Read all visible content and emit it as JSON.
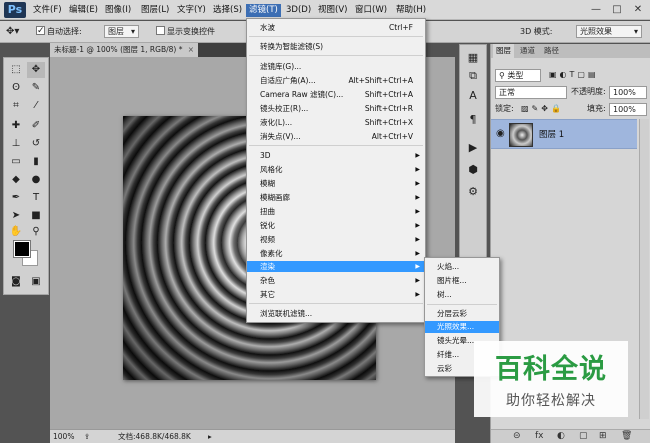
{
  "app": {
    "logo": "Ps"
  },
  "menubar": {
    "items": [
      "文件(F)",
      "编辑(E)",
      "图像(I)",
      "图层(L)",
      "文字(Y)",
      "选择(S)",
      "滤镜(T)",
      "3D(D)",
      "视图(V)",
      "窗口(W)",
      "帮助(H)"
    ],
    "active": "滤镜(T)",
    "window_controls": [
      "—",
      "□",
      "✕"
    ]
  },
  "options": {
    "auto_select_label": "自动选择:",
    "auto_select_checked": true,
    "auto_select_target": "图层",
    "show_transform_label": "显示变换控件",
    "mode_3d_label": "3D 模式:",
    "workspace": "光照效果"
  },
  "document": {
    "tab_title": "未标题-1 @ 100% (图层 1, RGB/8) *",
    "close": "×"
  },
  "statusbar": {
    "zoom": "100%",
    "doc_info": "文档:468.8K/468.8K"
  },
  "filter_menu": {
    "items": [
      {
        "label": "水波",
        "shortcut": "Ctrl+F"
      },
      {
        "label": "转换为智能滤镜(S)",
        "shortcut": ""
      },
      {
        "label": "滤镜库(G)...",
        "shortcut": ""
      },
      {
        "label": "自适应广角(A)...",
        "shortcut": "Alt+Shift+Ctrl+A"
      },
      {
        "label": "Camera Raw 滤镜(C)...",
        "shortcut": "Shift+Ctrl+A"
      },
      {
        "label": "镜头校正(R)...",
        "shortcut": "Shift+Ctrl+R"
      },
      {
        "label": "液化(L)...",
        "shortcut": "Shift+Ctrl+X"
      },
      {
        "label": "消失点(V)...",
        "shortcut": "Alt+Ctrl+V"
      },
      {
        "label": "3D",
        "shortcut": ""
      },
      {
        "label": "风格化",
        "shortcut": ""
      },
      {
        "label": "模糊",
        "shortcut": ""
      },
      {
        "label": "模糊画廊",
        "shortcut": ""
      },
      {
        "label": "扭曲",
        "shortcut": ""
      },
      {
        "label": "锐化",
        "shortcut": ""
      },
      {
        "label": "视频",
        "shortcut": ""
      },
      {
        "label": "像素化",
        "shortcut": ""
      },
      {
        "label": "渲染",
        "shortcut": ""
      },
      {
        "label": "杂色",
        "shortcut": ""
      },
      {
        "label": "其它",
        "shortcut": ""
      },
      {
        "label": "浏览联机滤镜...",
        "shortcut": ""
      }
    ],
    "highlighted": "渲染"
  },
  "render_menu": {
    "items": [
      "火焰...",
      "图片框...",
      "树...",
      "分层云彩",
      "光照效果...",
      "镜头光晕...",
      "纤维...",
      "云彩"
    ],
    "highlighted": "光照效果..."
  },
  "layers_panel": {
    "tabs": [
      "图层",
      "通道",
      "路径"
    ],
    "active_tab": "图层",
    "filter_kind": "类型",
    "blend_mode": "正常",
    "opacity_label": "不透明度:",
    "opacity": "100%",
    "lock_label": "锁定:",
    "fill_label": "填充:",
    "fill": "100%",
    "layer_name": "图层 1",
    "footer_icons": [
      "⊝",
      "fx",
      "◐",
      "▢",
      "⊞",
      "🗑"
    ]
  },
  "watermark": {
    "title": "百科全说",
    "subtitle": "助你轻松解决"
  }
}
